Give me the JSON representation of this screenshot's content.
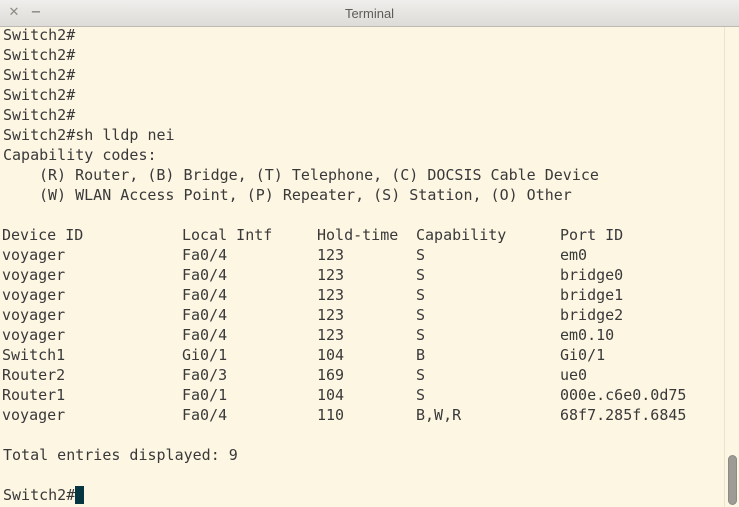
{
  "window": {
    "title": "Terminal",
    "close_icon": "close-icon",
    "minimize_icon": "minimize-icon",
    "close_glyph": "✕",
    "minimize_glyph": "−"
  },
  "terminal": {
    "background": "#fdf6e3",
    "foreground": "#39393a",
    "cursor_color": "#073642",
    "prompt_lines": [
      "Switch2#",
      "Switch2#",
      "Switch2#",
      "Switch2#",
      "Switch2#"
    ],
    "command_line": "Switch2#sh lldp nei",
    "capability_heading": "Capability codes:",
    "capability_codes_1": "(R) Router, (B) Bridge, (T) Telephone, (C) DOCSIS Cable Device",
    "capability_codes_2": "(W) WLAN Access Point, (P) Repeater, (S) Station, (O) Other",
    "table": {
      "headers": [
        "Device ID",
        "Local Intf",
        "Hold-time",
        "Capability",
        "Port ID"
      ],
      "rows": [
        [
          "voyager",
          "Fa0/4",
          "123",
          "S",
          "em0"
        ],
        [
          "voyager",
          "Fa0/4",
          "123",
          "S",
          "bridge0"
        ],
        [
          "voyager",
          "Fa0/4",
          "123",
          "S",
          "bridge1"
        ],
        [
          "voyager",
          "Fa0/4",
          "123",
          "S",
          "bridge2"
        ],
        [
          "voyager",
          "Fa0/4",
          "123",
          "S",
          "em0.10"
        ],
        [
          "Switch1",
          "Gi0/1",
          "104",
          "B",
          "Gi0/1"
        ],
        [
          "Router2",
          "Fa0/3",
          "169",
          "S",
          "ue0"
        ],
        [
          "Router1",
          "Fa0/1",
          "104",
          "S",
          "000e.c6e0.0d75"
        ],
        [
          "voyager",
          "Fa0/4",
          "110",
          "B,W,R",
          "68f7.285f.6845"
        ]
      ]
    },
    "total_line": "Total entries displayed: 9",
    "final_prompt": "Switch2#"
  }
}
